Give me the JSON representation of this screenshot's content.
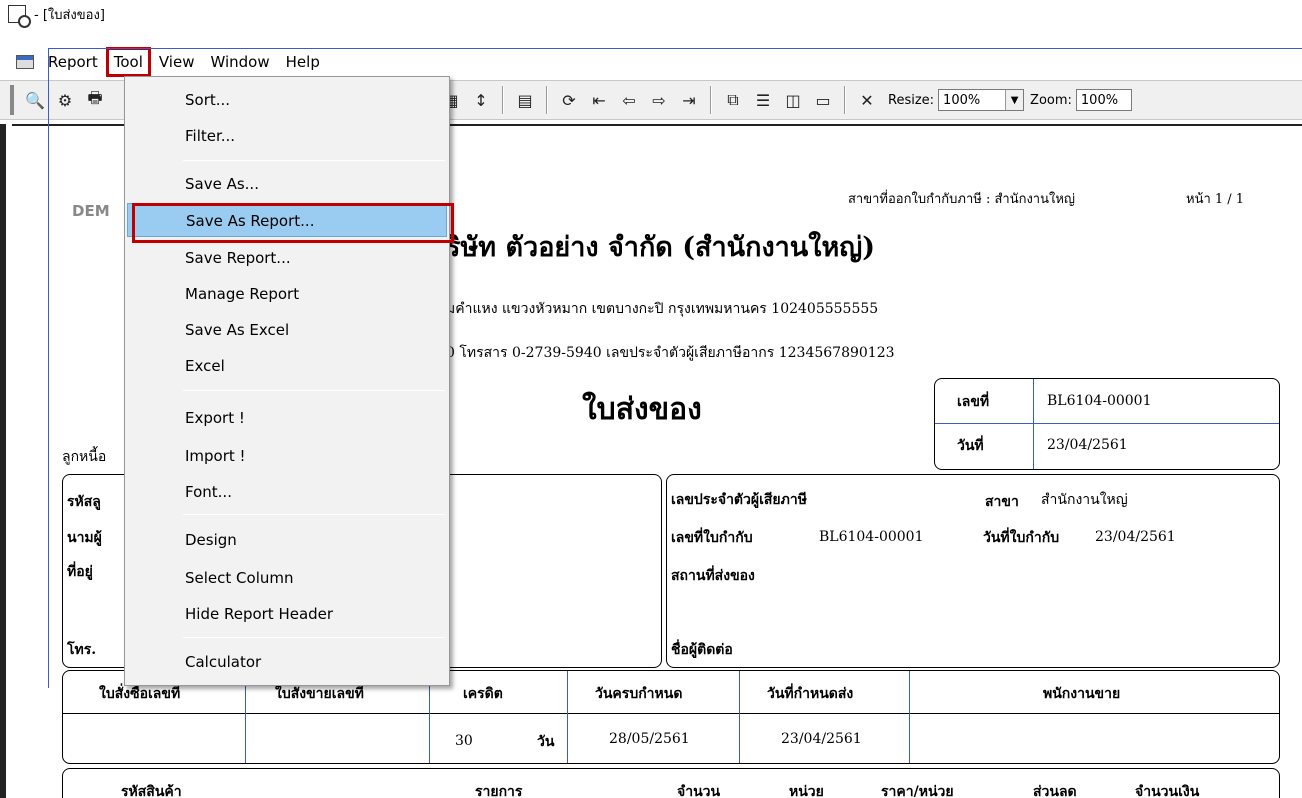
{
  "window": {
    "title": "- [ใบส่งของ]"
  },
  "menubar": {
    "items": [
      {
        "label": "Report"
      },
      {
        "label": "Tool"
      },
      {
        "label": "View"
      },
      {
        "label": "Window"
      },
      {
        "label": "Help"
      }
    ]
  },
  "toolbar": {
    "resize_label": "Resize:",
    "resize_value": "100%",
    "zoom_label": "Zoom:",
    "zoom_value": "100%"
  },
  "tool_menu": {
    "items": [
      {
        "label": "Sort..."
      },
      {
        "label": "Filter..."
      },
      {
        "label": "Save As..."
      },
      {
        "label": "Save As Report..."
      },
      {
        "label": "Save Report..."
      },
      {
        "label": "Manage Report"
      },
      {
        "label": "Save As Excel"
      },
      {
        "label": "Excel"
      },
      {
        "label": "Export !"
      },
      {
        "label": "Import !"
      },
      {
        "label": "Font..."
      },
      {
        "label": "Design"
      },
      {
        "label": "Select Column"
      },
      {
        "label": "Hide Report Header"
      },
      {
        "label": "Calculator"
      }
    ]
  },
  "report": {
    "demo": "DEM",
    "branch_issue": "สาขาที่ออกใบกำกับภาษี : สำนักงานใหญ่",
    "page_no": "หน้า 1 / 1",
    "company": "ริษัท ตัวอย่าง จำกัด   (สำนักงานใหญ่)",
    "address": "มคำแหง แขวงหัวหมาก เขตบางกะปิ กรุงเทพมหานคร 102405555555",
    "phone": "0  โทรสาร 0-2739-5940  เลขประจำตัวผู้เสียภาษีอากร 1234567890123",
    "doc_title": "ใบส่งของ",
    "doc_no_label": "เลขที่",
    "doc_no": "BL6104-00001",
    "date_label": "วันที่",
    "date": "23/04/2561",
    "customer_label": "ลูกหนี้อ",
    "cust_code_label": "รหัสลู",
    "cust_name_label": "นามผู้",
    "cust_addr_label": "ที่อยู่",
    "cust_tel_label": "โทร.",
    "cust_fax_tail": "ร",
    "tax_id_label": "เลขประจำตัวผู้เสียภาษี",
    "branch_label": "สาขา",
    "branch_value": "สำนักงานใหญ่",
    "invoice_no_label": "เลขที่ใบกำกับ",
    "invoice_no": "BL6104-00001",
    "invoice_date_label": "วันที่ใบกำกับ",
    "invoice_date": "23/04/2561",
    "ship_to_label": "สถานที่ส่งของ",
    "contact_label": "ชื่อผู้ติดต่อ",
    "headers": [
      "ใบสั่งซื้อเลขที่",
      "ใบสั่งขายเลขที่",
      "เครดิต",
      "วันครบกำหนด",
      "วันที่กำหนดส่ง",
      "พนักงานขาย"
    ],
    "row": {
      "credit_days": "30",
      "credit_unit": "วัน",
      "due_date": "28/05/2561",
      "delivery_date": "23/04/2561"
    },
    "item_headers": [
      "รหัสสินค้า",
      "รายการ",
      "จำนวน",
      "หน่วย",
      "ราคา/หน่วย",
      "ส่วนลด",
      "จำนวนเงิน"
    ]
  }
}
